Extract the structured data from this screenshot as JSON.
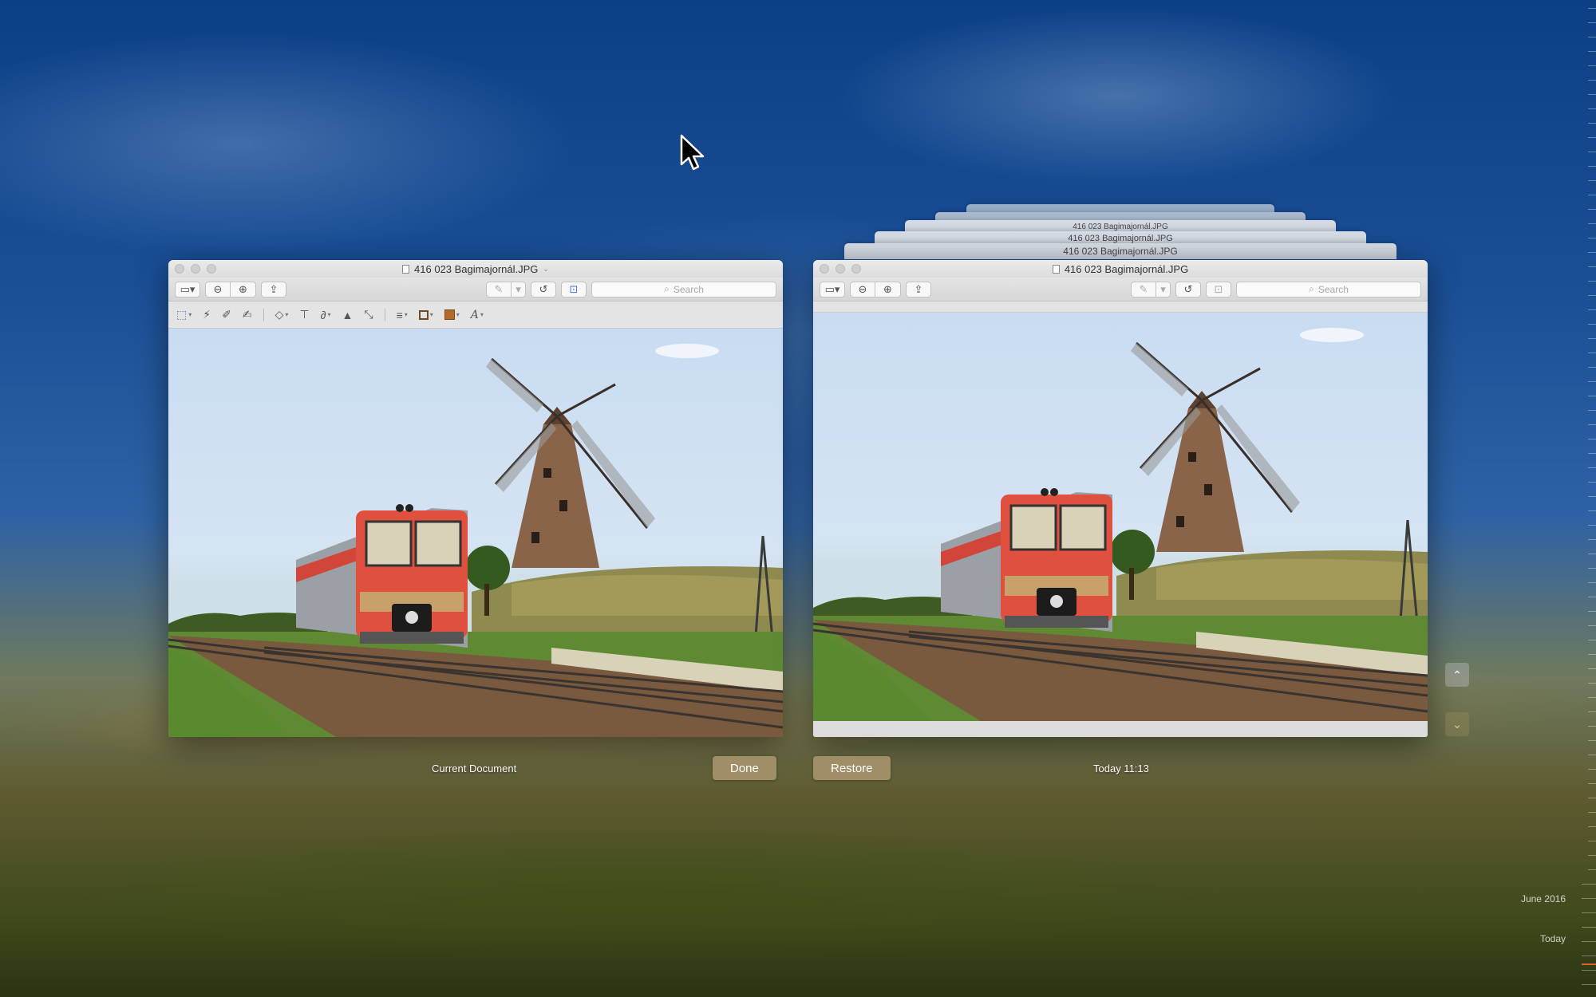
{
  "left_window": {
    "title": "416 023 Bagimajornál.JPG",
    "search_placeholder": "Search"
  },
  "right_window": {
    "title": "416 023 Bagimajornál.JPG",
    "search_placeholder": "Search"
  },
  "stacked_windows": [
    {
      "title": "416 023 Bagimajornál.JPG"
    },
    {
      "title": "416 023 Bagimajornál.JPG"
    },
    {
      "title": "416 023 Bagimajornál.JPG"
    }
  ],
  "captions": {
    "current": "Current Document",
    "version_time": "Today 11:13"
  },
  "buttons": {
    "done": "Done",
    "restore": "Restore"
  },
  "timeline": {
    "labels": [
      "June 2016",
      "Today"
    ]
  }
}
